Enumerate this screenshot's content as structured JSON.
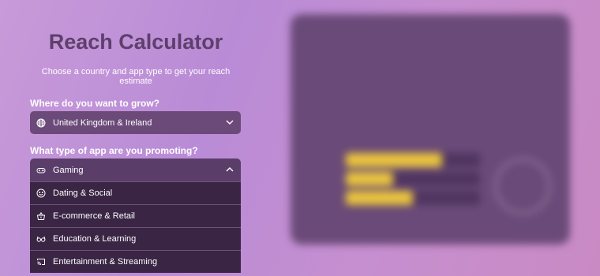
{
  "calculator": {
    "title": "Reach Calculator",
    "subtitle": "Choose a country and app type to get your reach estimate",
    "country_question": "Where do you want to grow?",
    "country_value": "United Kingdom & Ireland",
    "app_question": "What type of app are you promoting?",
    "app_value": "Gaming",
    "options": [
      {
        "label": "Dating & Social",
        "icon": "smiley-icon"
      },
      {
        "label": "E-commerce & Retail",
        "icon": "basket-icon"
      },
      {
        "label": "Education & Learning",
        "icon": "glasses-icon"
      },
      {
        "label": "Entertainment & Streaming",
        "icon": "cast-icon"
      }
    ]
  },
  "results": {
    "kicker": "",
    "headline_highlight": "",
    "headline_rest": "",
    "description": "",
    "note": "",
    "bars": [
      0.72,
      0.35,
      0.5
    ]
  },
  "colors": {
    "accent": "#e9c43e",
    "panel": "#6a4a78",
    "select": "#6b4a79",
    "dropdown": "#3a2544"
  }
}
